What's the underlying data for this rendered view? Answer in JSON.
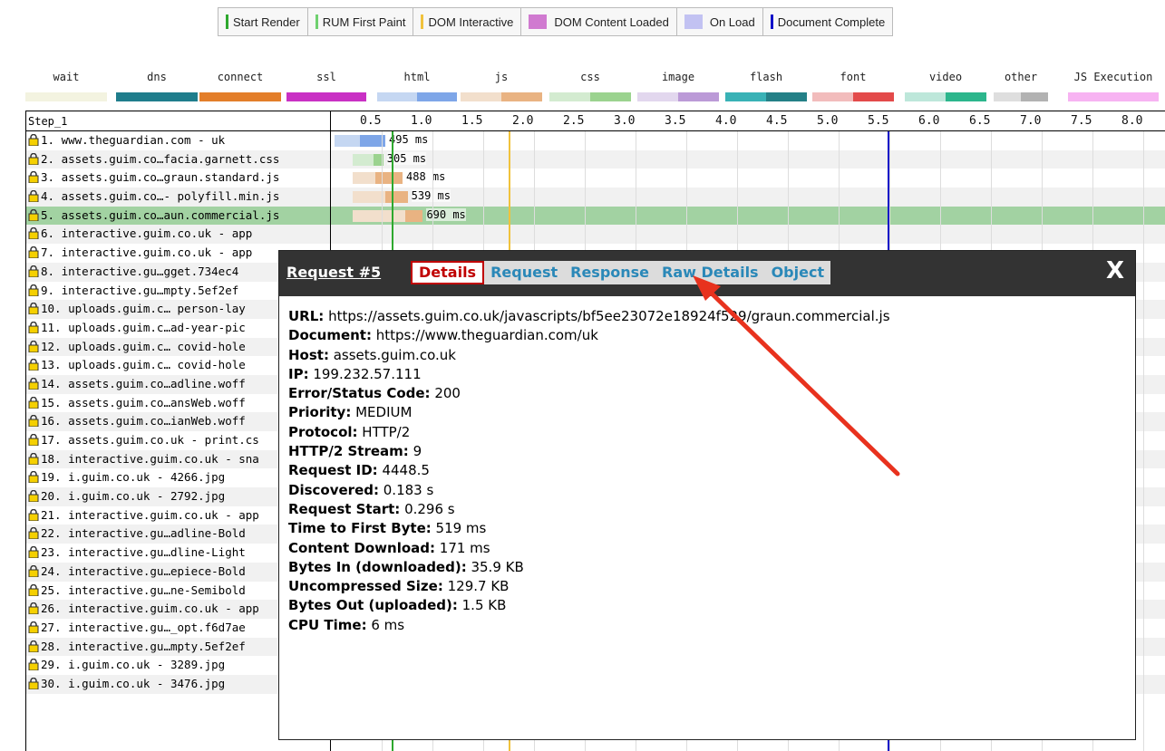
{
  "markers": [
    {
      "label": "Start Render",
      "color": "#2ea82e",
      "kind": "line"
    },
    {
      "label": "RUM First Paint",
      "color": "#6fd06f",
      "kind": "line"
    },
    {
      "label": "DOM Interactive",
      "color": "#f0c23c",
      "kind": "line"
    },
    {
      "label": "DOM Content Loaded",
      "color": "#d07ad0",
      "kind": "block"
    },
    {
      "label": "On Load",
      "color": "#c2c2f2",
      "kind": "block"
    },
    {
      "label": "Document Complete",
      "color": "#1010c8",
      "kind": "line"
    }
  ],
  "types": [
    {
      "label": "wait",
      "c1": "#f3f3e0",
      "c2": "#f3f3e0"
    },
    {
      "label": "dns",
      "c1": "#1f7d8c",
      "c2": "#1f7d8c"
    },
    {
      "label": "connect",
      "c1": "#e37e2a",
      "c2": "#e37e2a"
    },
    {
      "label": "ssl",
      "c1": "#c930c4",
      "c2": "#c930c4"
    },
    {
      "label": "html",
      "c1": "#c5d7f2",
      "c2": "#7ea6e8"
    },
    {
      "label": "js",
      "c1": "#f2dfcc",
      "c2": "#e9b382"
    },
    {
      "label": "css",
      "c1": "#d3ebd0",
      "c2": "#9bd38f"
    },
    {
      "label": "image",
      "c1": "#e2d7ee",
      "c2": "#bb9ad7"
    },
    {
      "label": "flash",
      "c1": "#39b2b6",
      "c2": "#248087"
    },
    {
      "label": "font",
      "c1": "#f2bcbc",
      "c2": "#e34a4a"
    },
    {
      "label": "video",
      "c1": "#bde7da",
      "c2": "#2cb68c"
    },
    {
      "label": "other",
      "c1": "#dedede",
      "c2": "#b2b2b2"
    },
    {
      "label": "JS Execution",
      "c1": "#f7b3f2",
      "c2": "#f7b3f2"
    }
  ],
  "waterfall": {
    "step": "Step_1",
    "ticks": [
      "0.5",
      "1.0",
      "1.5",
      "2.0",
      "2.5",
      "3.0",
      "3.5",
      "4.0",
      "4.5",
      "5.0",
      "5.5",
      "6.0",
      "6.5",
      "7.0",
      "7.5",
      "8.0"
    ],
    "rows": [
      {
        "label": "1. www.theguardian.com - uk",
        "type": "html",
        "start": 0.0,
        "ttfb": 0.25,
        "dl": 0.25,
        "time": "495 ms"
      },
      {
        "label": "2. assets.guim.co…facia.garnett.css",
        "type": "css",
        "start": 0.18,
        "ttfb": 0.2,
        "dl": 0.1,
        "time": "305 ms"
      },
      {
        "label": "3. assets.guim.co…graun.standard.js",
        "type": "js",
        "start": 0.18,
        "ttfb": 0.22,
        "dl": 0.27,
        "time": "488 ms"
      },
      {
        "label": "4. assets.guim.co…- polyfill.min.js",
        "type": "js",
        "start": 0.18,
        "ttfb": 0.32,
        "dl": 0.22,
        "time": "539 ms"
      },
      {
        "label": "5. assets.guim.co…aun.commercial.js",
        "type": "js",
        "start": 0.18,
        "ttfb": 0.52,
        "dl": 0.17,
        "time": "690 ms"
      },
      {
        "label": "6. interactive.guim.co.uk - app"
      },
      {
        "label": "7. interactive.guim.co.uk - app"
      },
      {
        "label": "8. interactive.gu…gget.734ec4"
      },
      {
        "label": "9. interactive.gu…mpty.5ef2ef"
      },
      {
        "label": "10. uploads.guim.c… person-lay"
      },
      {
        "label": "11. uploads.guim.c…ad-year-pic"
      },
      {
        "label": "12. uploads.guim.c… covid-hole"
      },
      {
        "label": "13. uploads.guim.c… covid-hole"
      },
      {
        "label": "14. assets.guim.co…adline.woff"
      },
      {
        "label": "15. assets.guim.co…ansWeb.woff"
      },
      {
        "label": "16. assets.guim.co…ianWeb.woff"
      },
      {
        "label": "17. assets.guim.co.uk - print.cs"
      },
      {
        "label": "18. interactive.guim.co.uk - sna"
      },
      {
        "label": "19. i.guim.co.uk - 4266.jpg"
      },
      {
        "label": "20. i.guim.co.uk - 2792.jpg"
      },
      {
        "label": "21. interactive.guim.co.uk - app"
      },
      {
        "label": "22. interactive.gu…adline-Bold"
      },
      {
        "label": "23. interactive.gu…dline-Light"
      },
      {
        "label": "24. interactive.gu…epiece-Bold"
      },
      {
        "label": "25. interactive.gu…ne-Semibold"
      },
      {
        "label": "26. interactive.guim.co.uk - app"
      },
      {
        "label": "27. interactive.gu…_opt.f6d7ae"
      },
      {
        "label": "28. interactive.gu…mpty.5ef2ef"
      },
      {
        "label": "29. i.guim.co.uk - 3289.jpg"
      },
      {
        "label": "30. i.guim.co.uk - 3476.jpg"
      }
    ]
  },
  "popup": {
    "title": "Request #5",
    "tabs": [
      "Details",
      "Request",
      "Response",
      "Raw Details",
      "Object"
    ],
    "active_tab": "Details",
    "close": "X",
    "fields": [
      {
        "k": "URL:",
        "v": "https://assets.guim.co.uk/javascripts/bf5ee23072e18924f529/graun.commercial.js"
      },
      {
        "k": "Document:",
        "v": "https://www.theguardian.com/uk"
      },
      {
        "k": "Host:",
        "v": "assets.guim.co.uk"
      },
      {
        "k": "IP:",
        "v": "199.232.57.111"
      },
      {
        "k": "Error/Status Code:",
        "v": "200"
      },
      {
        "k": "Priority:",
        "v": "MEDIUM"
      },
      {
        "k": "Protocol:",
        "v": "HTTP/2"
      },
      {
        "k": "HTTP/2 Stream:",
        "v": "9"
      },
      {
        "k": "Request ID:",
        "v": "4448.5"
      },
      {
        "k": "Discovered:",
        "v": "0.183 s"
      },
      {
        "k": "Request Start:",
        "v": "0.296 s"
      },
      {
        "k": "Time to First Byte:",
        "v": "519 ms"
      },
      {
        "k": "Content Download:",
        "v": "171 ms"
      },
      {
        "k": "Bytes In (downloaded):",
        "v": "35.9 KB"
      },
      {
        "k": "Uncompressed Size:",
        "v": "129.7 KB"
      },
      {
        "k": "Bytes Out (uploaded):",
        "v": "1.5 KB"
      },
      {
        "k": "CPU Time:",
        "v": "6 ms"
      }
    ]
  },
  "annotation": {
    "color": "#e8321e",
    "kind": "arrow",
    "points_to": "Raw Details"
  }
}
